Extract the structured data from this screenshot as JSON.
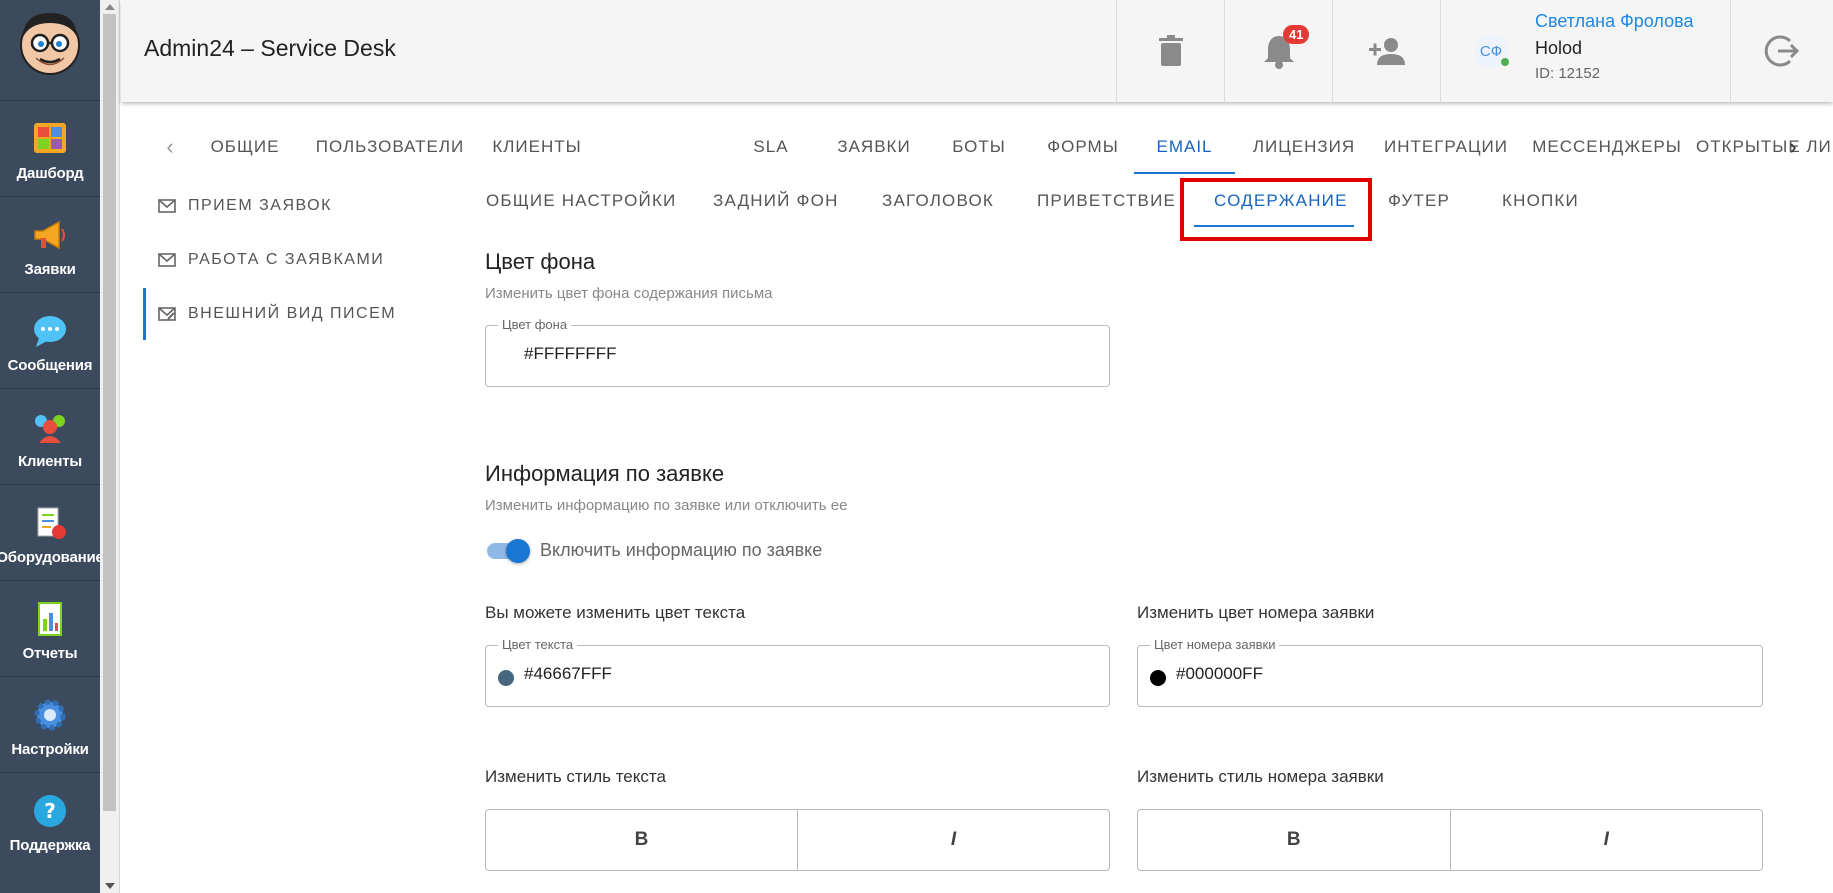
{
  "sidebar": {
    "items": [
      {
        "label": "Дашборд",
        "icon": "dashboard-icon"
      },
      {
        "label": "Заявки",
        "icon": "megaphone-icon"
      },
      {
        "label": "Сообщения",
        "icon": "chat-bubble-icon"
      },
      {
        "label": "Клиенты",
        "icon": "clients-icon"
      },
      {
        "label": "Оборудование",
        "icon": "equipment-icon"
      },
      {
        "label": "Отчеты",
        "icon": "report-icon"
      },
      {
        "label": "Настройки",
        "icon": "gear-icon"
      },
      {
        "label": "Поддержка",
        "icon": "help-icon"
      }
    ]
  },
  "header": {
    "title": "Admin24 – Service Desk",
    "notifications_count": "41",
    "user": {
      "initials": "СФ",
      "name": "Светлана Фролова",
      "org": "Holod",
      "id": "ID: 12152"
    }
  },
  "main_tabs": [
    {
      "label": "ОБЩИЕ"
    },
    {
      "label": "ПОЛЬЗОВАТЕЛИ"
    },
    {
      "label": "КЛИЕНТЫ"
    },
    {
      "label": "SLA"
    },
    {
      "label": "ЗАЯВКИ"
    },
    {
      "label": "БОТЫ"
    },
    {
      "label": "ФОРМЫ"
    },
    {
      "label": "EMAIL"
    },
    {
      "label": "ЛИЦЕНЗИЯ"
    },
    {
      "label": "ИНТЕГРАЦИИ"
    },
    {
      "label": "МЕССЕНДЖЕРЫ"
    },
    {
      "label": "ОТКРЫТЫЕ ЛИНИИ"
    }
  ],
  "main_tabs_active": "EMAIL",
  "sub_nav": [
    {
      "label": "ПРИЕМ ЗАЯВОК"
    },
    {
      "label": "РАБОТА С ЗАЯВКАМИ"
    },
    {
      "label": "ВНЕШНИЙ ВИД ПИСЕМ"
    }
  ],
  "secondary_tabs": [
    {
      "label": "ОБЩИЕ НАСТРОЙКИ"
    },
    {
      "label": "ЗАДНИЙ ФОН"
    },
    {
      "label": "ЗАГОЛОВОК"
    },
    {
      "label": "ПРИВЕТСТВИЕ"
    },
    {
      "label": "СОДЕРЖАНИЕ"
    },
    {
      "label": "ФУТЕР"
    },
    {
      "label": "КНОПКИ"
    }
  ],
  "secondary_tabs_active": "СОДЕРЖАНИЕ",
  "bg_section": {
    "title": "Цвет фона",
    "subtitle": "Изменить цвет фона содержания письма",
    "field_label": "Цвет фона",
    "value": "#FFFFFFFF"
  },
  "info_section": {
    "title": "Информация по заявке",
    "subtitle": "Изменить информацию по заявке или отключить ее",
    "toggle_label": "Включить информацию по заявке",
    "toggle_on": true,
    "text_color_heading": "Вы можете изменить цвет текста",
    "text_color_label": "Цвет текста",
    "text_color_value": "#46667FFF",
    "text_color_swatch": "#46667F",
    "number_color_heading": "Изменить цвет номера заявки",
    "number_color_label": "Цвет номера заявки",
    "number_color_value": "#000000FF",
    "number_color_swatch": "#000000",
    "text_style_heading": "Изменить стиль текста",
    "number_style_heading": "Изменить стиль номера заявки",
    "bold_label": "B",
    "italic_label": "I"
  },
  "colors": {
    "sidebar_bg": "#3b4a5d",
    "accent": "#1976d2",
    "highlight": "#e00000",
    "badge": "#e53935"
  }
}
